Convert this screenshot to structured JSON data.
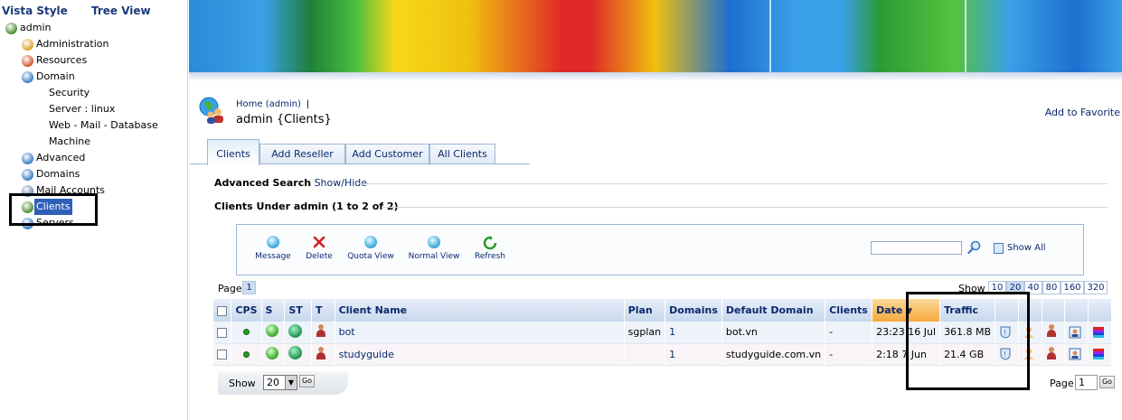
{
  "sidebar": {
    "tab_vista": "Vista Style",
    "tab_tree": "Tree View",
    "items": [
      {
        "label": "admin",
        "icon": "globe-users-icon",
        "color": "#4b8d2e"
      },
      {
        "label": "Administration",
        "icon": "admin-person-icon",
        "color": "#e3a12e"
      },
      {
        "label": "Resources",
        "icon": "resources-icon",
        "color": "#d0582a"
      },
      {
        "label": "Domain",
        "icon": "globe-icon",
        "color": "#3a7ec6"
      },
      {
        "label": "Security",
        "icon": "",
        "color": ""
      },
      {
        "label": "Server  : linux",
        "icon": "",
        "color": ""
      },
      {
        "label": "Web - Mail - Database",
        "icon": "",
        "color": ""
      },
      {
        "label": "Machine",
        "icon": "",
        "color": ""
      },
      {
        "label": "Advanced",
        "icon": "advanced-icon",
        "color": "#3a7ec6"
      },
      {
        "label": "Domains",
        "icon": "domains-icon",
        "color": "#3a7ec6"
      },
      {
        "label": "Mail Accounts",
        "icon": "mail-icon",
        "color": "#6a8ab0"
      },
      {
        "label": "Clients",
        "icon": "clients-icon",
        "color": "#4b8d2e"
      },
      {
        "label": "Servers",
        "icon": "servers-icon",
        "color": "#3a7ec6"
      }
    ]
  },
  "header": {
    "home_link": "Home (admin)",
    "separator": "|",
    "title": "admin {Clients}",
    "add_favorite": "Add to Favorite"
  },
  "tabs": [
    "Clients",
    "Add Reseller",
    "Add Customer",
    "All Clients"
  ],
  "advanced_search": {
    "label": "Advanced Search",
    "toggle": "Show/Hide"
  },
  "clients_under": "Clients Under admin (1 to 2 of 2)",
  "toolbar": {
    "buttons": [
      "Message",
      "Delete",
      "Quota View",
      "Normal View",
      "Refresh"
    ],
    "search_value": "",
    "show_all": "Show All"
  },
  "paging": {
    "page_label": "Page",
    "current_page": "1",
    "show_label": "Show",
    "sizes": [
      "10",
      "20",
      "40",
      "80",
      "160",
      "320"
    ],
    "selected_size": "20"
  },
  "table": {
    "columns": [
      "CPS",
      "S",
      "ST",
      "T",
      "Client Name",
      "Plan",
      "Domains",
      "Default Domain",
      "Clients",
      "Date",
      "Traffic"
    ],
    "rows": [
      {
        "client": "bot",
        "plan": "sgplan",
        "domains": "1",
        "default_domain": "bot.vn",
        "clients": "-",
        "date": "23:23 16 Jul",
        "traffic": "361.8 MB"
      },
      {
        "client": "studyguide",
        "plan": "",
        "domains": "1",
        "default_domain": "studyguide.com.vn",
        "clients": "-",
        "date": "2:18  7 Jun",
        "traffic": "21.4 GB"
      }
    ]
  },
  "footer": {
    "show_label": "Show",
    "per_page": "20",
    "go": "Go",
    "page_label": "Page",
    "page_value": "1"
  },
  "colors": {
    "accent": "#0a2a6e",
    "date_header": "#f6a93b"
  }
}
